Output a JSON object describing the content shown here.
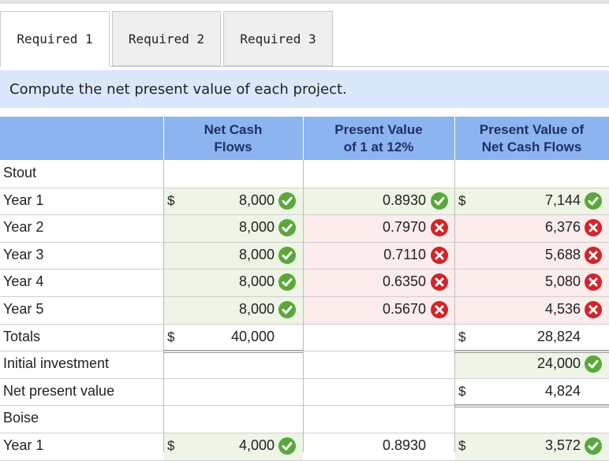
{
  "tabs": [
    {
      "label": "Required 1",
      "active": true
    },
    {
      "label": "Required 2",
      "active": false
    },
    {
      "label": "Required 3",
      "active": false
    }
  ],
  "instruction": "Compute the net present value of each project.",
  "columns": {
    "cash": "Net Cash\nFlows",
    "pv": "Present Value\nof 1 at 12%",
    "pvcash": "Present Value of\nNet Cash Flows"
  },
  "rows": [
    {
      "label": "Stout"
    },
    {
      "label": "Year 1",
      "cash_dollar": "$",
      "cash": "8,000",
      "cash_mark": "correct",
      "pv": "0.8930",
      "pv_mark": "correct",
      "pvcash_dollar": "$",
      "pvcash": "7,144",
      "pvcash_mark": "correct"
    },
    {
      "label": "Year 2",
      "cash": "8,000",
      "cash_mark": "correct",
      "pv": "0.7970",
      "pv_mark": "incorrect",
      "pvcash": "6,376",
      "pvcash_mark": "incorrect"
    },
    {
      "label": "Year 3",
      "cash": "8,000",
      "cash_mark": "correct",
      "pv": "0.7110",
      "pv_mark": "incorrect",
      "pvcash": "5,688",
      "pvcash_mark": "incorrect"
    },
    {
      "label": "Year 4",
      "cash": "8,000",
      "cash_mark": "correct",
      "pv": "0.6350",
      "pv_mark": "incorrect",
      "pvcash": "5,080",
      "pvcash_mark": "incorrect"
    },
    {
      "label": "Year 5",
      "cash": "8,000",
      "cash_mark": "correct",
      "pv": "0.5670",
      "pv_mark": "incorrect",
      "pvcash": "4,536",
      "pvcash_mark": "incorrect"
    },
    {
      "label": "Totals",
      "cash_dollar": "$",
      "cash": "40,000",
      "pvcash_dollar": "$",
      "pvcash": "28,824"
    },
    {
      "label": "Initial investment",
      "pvcash": "24,000",
      "pvcash_mark": "correct"
    },
    {
      "label": "Net present value",
      "pvcash_dollar": "$",
      "pvcash": "4,824"
    },
    {
      "label": "Boise"
    },
    {
      "label": "Year 1",
      "cash_dollar": "$",
      "cash": "4,000",
      "cash_mark": "correct",
      "pv": "0.8930",
      "pvcash_dollar": "$",
      "pvcash": "3,572",
      "pvcash_mark": "correct"
    }
  ],
  "colors": {
    "header": "#8cb4f0",
    "instruction_bg": "#d9e8fb",
    "correct": "#5aa83c",
    "incorrect": "#d3242a"
  },
  "icons": {
    "correct": "check-circle-icon",
    "incorrect": "x-circle-icon"
  }
}
